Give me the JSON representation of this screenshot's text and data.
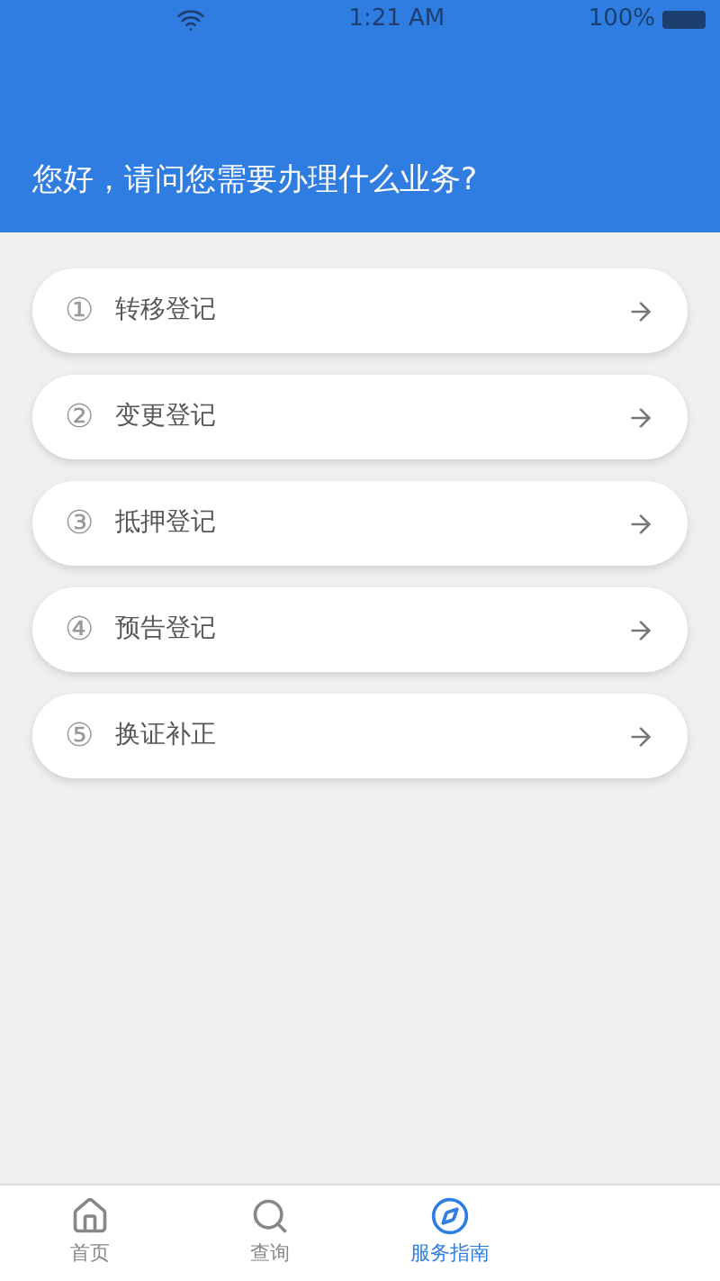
{
  "status_bar": {
    "time": "1:21 AM",
    "battery": "100%"
  },
  "header": {
    "title": "您好，请问您需要办理什么业务?"
  },
  "services": [
    {
      "number": "①",
      "label": "转移登记"
    },
    {
      "number": "②",
      "label": "变更登记"
    },
    {
      "number": "③",
      "label": "抵押登记"
    },
    {
      "number": "④",
      "label": "预告登记"
    },
    {
      "number": "⑤",
      "label": "换证补正"
    }
  ],
  "tabs": [
    {
      "label": "首页",
      "kind": "home",
      "selected": false
    },
    {
      "label": "查询",
      "kind": "search",
      "selected": false
    },
    {
      "label": "服务指南",
      "kind": "compass",
      "selected": true
    }
  ]
}
